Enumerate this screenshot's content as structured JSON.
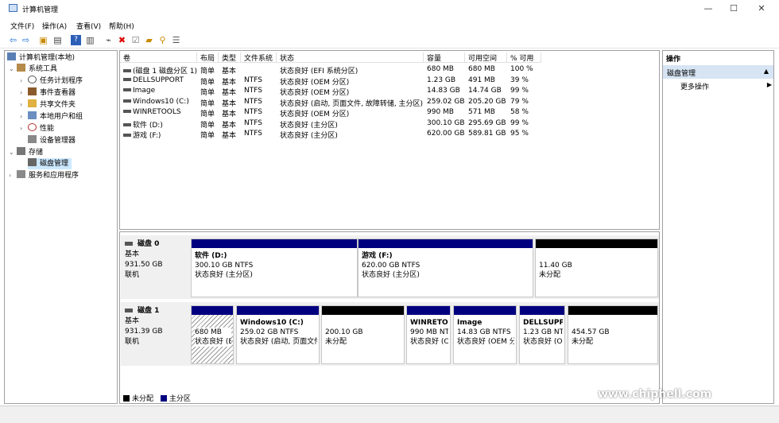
{
  "window": {
    "title": "计算机管理",
    "minimize": "—",
    "maximize": "☐",
    "close": "✕"
  },
  "menu": [
    "文件(F)",
    "操作(A)",
    "查看(V)",
    "帮助(H)"
  ],
  "tree": {
    "root": "计算机管理(本地)",
    "system_tools": "系统工具",
    "task_scheduler": "任务计划程序",
    "event_viewer": "事件查看器",
    "shared_folders": "共享文件夹",
    "local_users": "本地用户和组",
    "performance": "性能",
    "device_manager": "设备管理器",
    "storage": "存储",
    "disk_management": "磁盘管理",
    "services": "服务和应用程序"
  },
  "volume_headers": [
    "卷",
    "布局",
    "类型",
    "文件系统",
    "状态",
    "容量",
    "可用空间",
    "% 可用"
  ],
  "volumes": [
    [
      "(磁盘 1 磁盘分区 1)",
      "简单",
      "基本",
      "",
      "状态良好 (EFI 系统分区)",
      "680 MB",
      "680 MB",
      "100 %"
    ],
    [
      "DELLSUPPORT",
      "简单",
      "基本",
      "NTFS",
      "状态良好 (OEM 分区)",
      "1.23 GB",
      "491 MB",
      "39 %"
    ],
    [
      "Image",
      "简单",
      "基本",
      "NTFS",
      "状态良好 (OEM 分区)",
      "14.83 GB",
      "14.74 GB",
      "99 %"
    ],
    [
      "Windows10 (C:)",
      "简单",
      "基本",
      "NTFS",
      "状态良好 (启动, 页面文件, 故障转储, 主分区)",
      "259.02 GB",
      "205.20 GB",
      "79 %"
    ],
    [
      "WINRETOOLS",
      "简单",
      "基本",
      "NTFS",
      "状态良好 (OEM 分区)",
      "990 MB",
      "571 MB",
      "58 %"
    ],
    [
      "软件 (D:)",
      "简单",
      "基本",
      "NTFS",
      "状态良好 (主分区)",
      "300.10 GB",
      "295.69 GB",
      "99 %"
    ],
    [
      "游戏 (F:)",
      "简单",
      "基本",
      "NTFS",
      "状态良好 (主分区)",
      "620.00 GB",
      "589.81 GB",
      "95 %"
    ]
  ],
  "disks": [
    {
      "name": "磁盘 0",
      "type": "基本",
      "size": "931.50 GB",
      "status": "联机",
      "parts": [
        {
          "title": "软件 (D:)",
          "l1": "300.10 GB NTFS",
          "l2": "状态良好 (主分区)",
          "kind": "primary"
        },
        {
          "title": "游戏 (F:)",
          "l1": "620.00 GB NTFS",
          "l2": "状态良好 (主分区)",
          "kind": "primary"
        },
        {
          "title": "",
          "l1": "11.40 GB",
          "l2": "未分配",
          "kind": "unalloc"
        }
      ]
    },
    {
      "name": "磁盘 1",
      "type": "基本",
      "size": "931.39 GB",
      "status": "联机",
      "parts": [
        {
          "title": "",
          "l1": "680 MB",
          "l2": "状态良好 (E",
          "kind": "primary"
        },
        {
          "title": "Windows10 (C:)",
          "l1": "259.02 GB NTFS",
          "l2": "状态良好 (启动, 页面文件",
          "kind": "primary"
        },
        {
          "title": "",
          "l1": "200.10 GB",
          "l2": "未分配",
          "kind": "unalloc"
        },
        {
          "title": "WINRETO",
          "l1": "990 MB NT",
          "l2": "状态良好 (C",
          "kind": "primary"
        },
        {
          "title": "Image",
          "l1": "14.83 GB NTFS",
          "l2": "状态良好 (OEM 分",
          "kind": "primary"
        },
        {
          "title": "DELLSUPPO",
          "l1": "1.23 GB NT",
          "l2": "状态良好 (O",
          "kind": "primary"
        },
        {
          "title": "",
          "l1": "454.57 GB",
          "l2": "未分配",
          "kind": "unalloc"
        }
      ]
    }
  ],
  "legend": {
    "unallocated": "未分配",
    "primary": "主分区"
  },
  "colors": {
    "primary": "#00007f",
    "unalloc": "#000000",
    "selected": "#cce8ff"
  },
  "actions": {
    "header": "操作",
    "section": "磁盘管理",
    "more": "更多操作"
  },
  "watermark": "www.chiphell.com"
}
